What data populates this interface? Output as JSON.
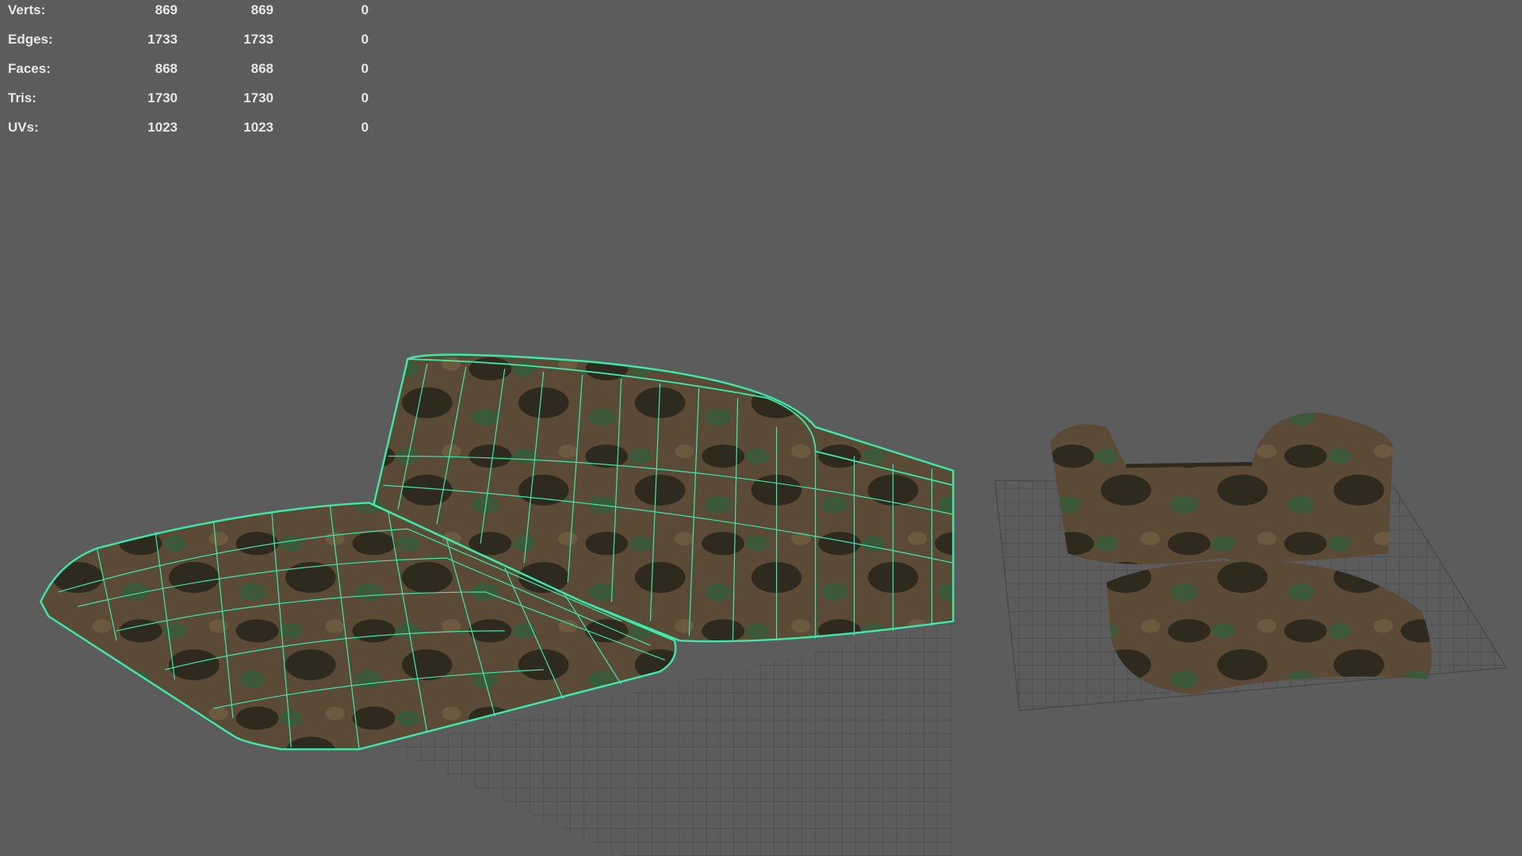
{
  "heads_up_display": {
    "rows": [
      {
        "label": "Verts:",
        "values": [
          "869",
          "869",
          "0"
        ]
      },
      {
        "label": "Edges:",
        "values": [
          "1733",
          "1733",
          "0"
        ]
      },
      {
        "label": "Faces:",
        "values": [
          "868",
          "868",
          "0"
        ]
      },
      {
        "label": "Tris:",
        "values": [
          "1730",
          "1730",
          "0"
        ]
      },
      {
        "label": "UVs:",
        "values": [
          "1023",
          "1023",
          "0"
        ]
      }
    ]
  },
  "colors": {
    "background": "#5c5c5c",
    "wireframe": "#3fe8a8",
    "camo_base": "#5a4a36",
    "camo_dark": "#2e2a1e",
    "camo_green": "#3c5a3a",
    "grid": "#444444"
  }
}
